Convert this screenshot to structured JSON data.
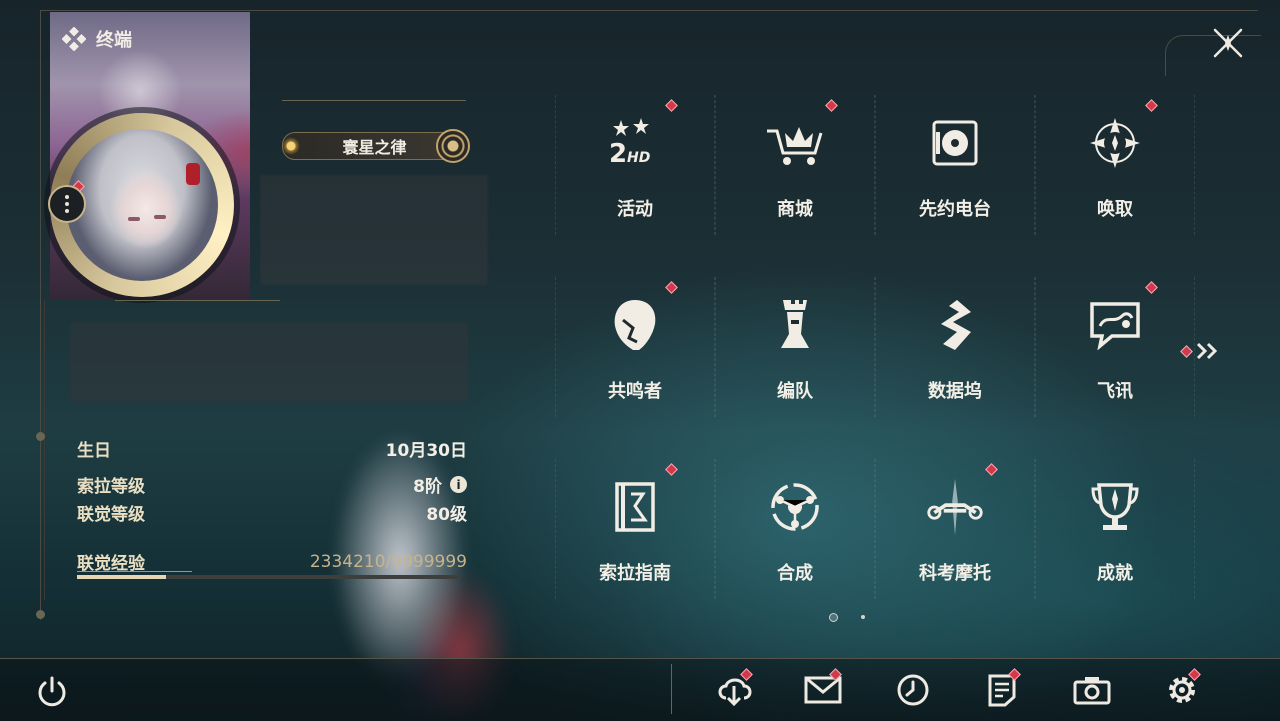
{
  "window": {
    "title": "终端"
  },
  "profile": {
    "title_badge": "寰星之律",
    "stats": [
      {
        "label": "生日",
        "value": "10月30日"
      },
      {
        "label": "索拉等级",
        "value": "8阶"
      },
      {
        "label": "联觉等级",
        "value": "80级"
      }
    ],
    "exp": {
      "label": "联觉经验",
      "value": "2334210/9999999",
      "current": 2334210,
      "max": 9999999,
      "fraction": 0.2334
    }
  },
  "menu": {
    "items": [
      {
        "label": "活动",
        "icon": "event-2nd-hd-icon",
        "badge": true
      },
      {
        "label": "商城",
        "icon": "shopping-cart-icon",
        "badge": true
      },
      {
        "label": "先约电台",
        "icon": "radio-pass-icon",
        "badge": false
      },
      {
        "label": "唤取",
        "icon": "gacha-star-icon",
        "badge": true
      },
      {
        "label": "共鸣者",
        "icon": "resonator-head-icon",
        "badge": true
      },
      {
        "label": "编队",
        "icon": "chess-team-icon",
        "badge": false
      },
      {
        "label": "数据坞",
        "icon": "data-bank-icon",
        "badge": false
      },
      {
        "label": "飞讯",
        "icon": "message-chat-icon",
        "badge": true
      },
      {
        "label": "索拉指南",
        "icon": "guide-book-icon",
        "badge": true
      },
      {
        "label": "合成",
        "icon": "synthesis-icon",
        "badge": false
      },
      {
        "label": "科考摩托",
        "icon": "motorcycle-icon",
        "badge": true
      },
      {
        "label": "成就",
        "icon": "trophy-icon",
        "badge": false
      }
    ],
    "page_count": 2,
    "current_page": 1
  },
  "bottom_bar": [
    {
      "name": "download-icon",
      "badge": true
    },
    {
      "name": "mail-icon",
      "badge": true
    },
    {
      "name": "clock-icon",
      "badge": false
    },
    {
      "name": "notes-icon",
      "badge": true
    },
    {
      "name": "camera-icon",
      "badge": false
    },
    {
      "name": "settings-gear-icon",
      "badge": true
    }
  ],
  "colors": {
    "accent_gold": "#c7b48a",
    "badge_red": "#d4384b",
    "text": "#f3efe6"
  }
}
